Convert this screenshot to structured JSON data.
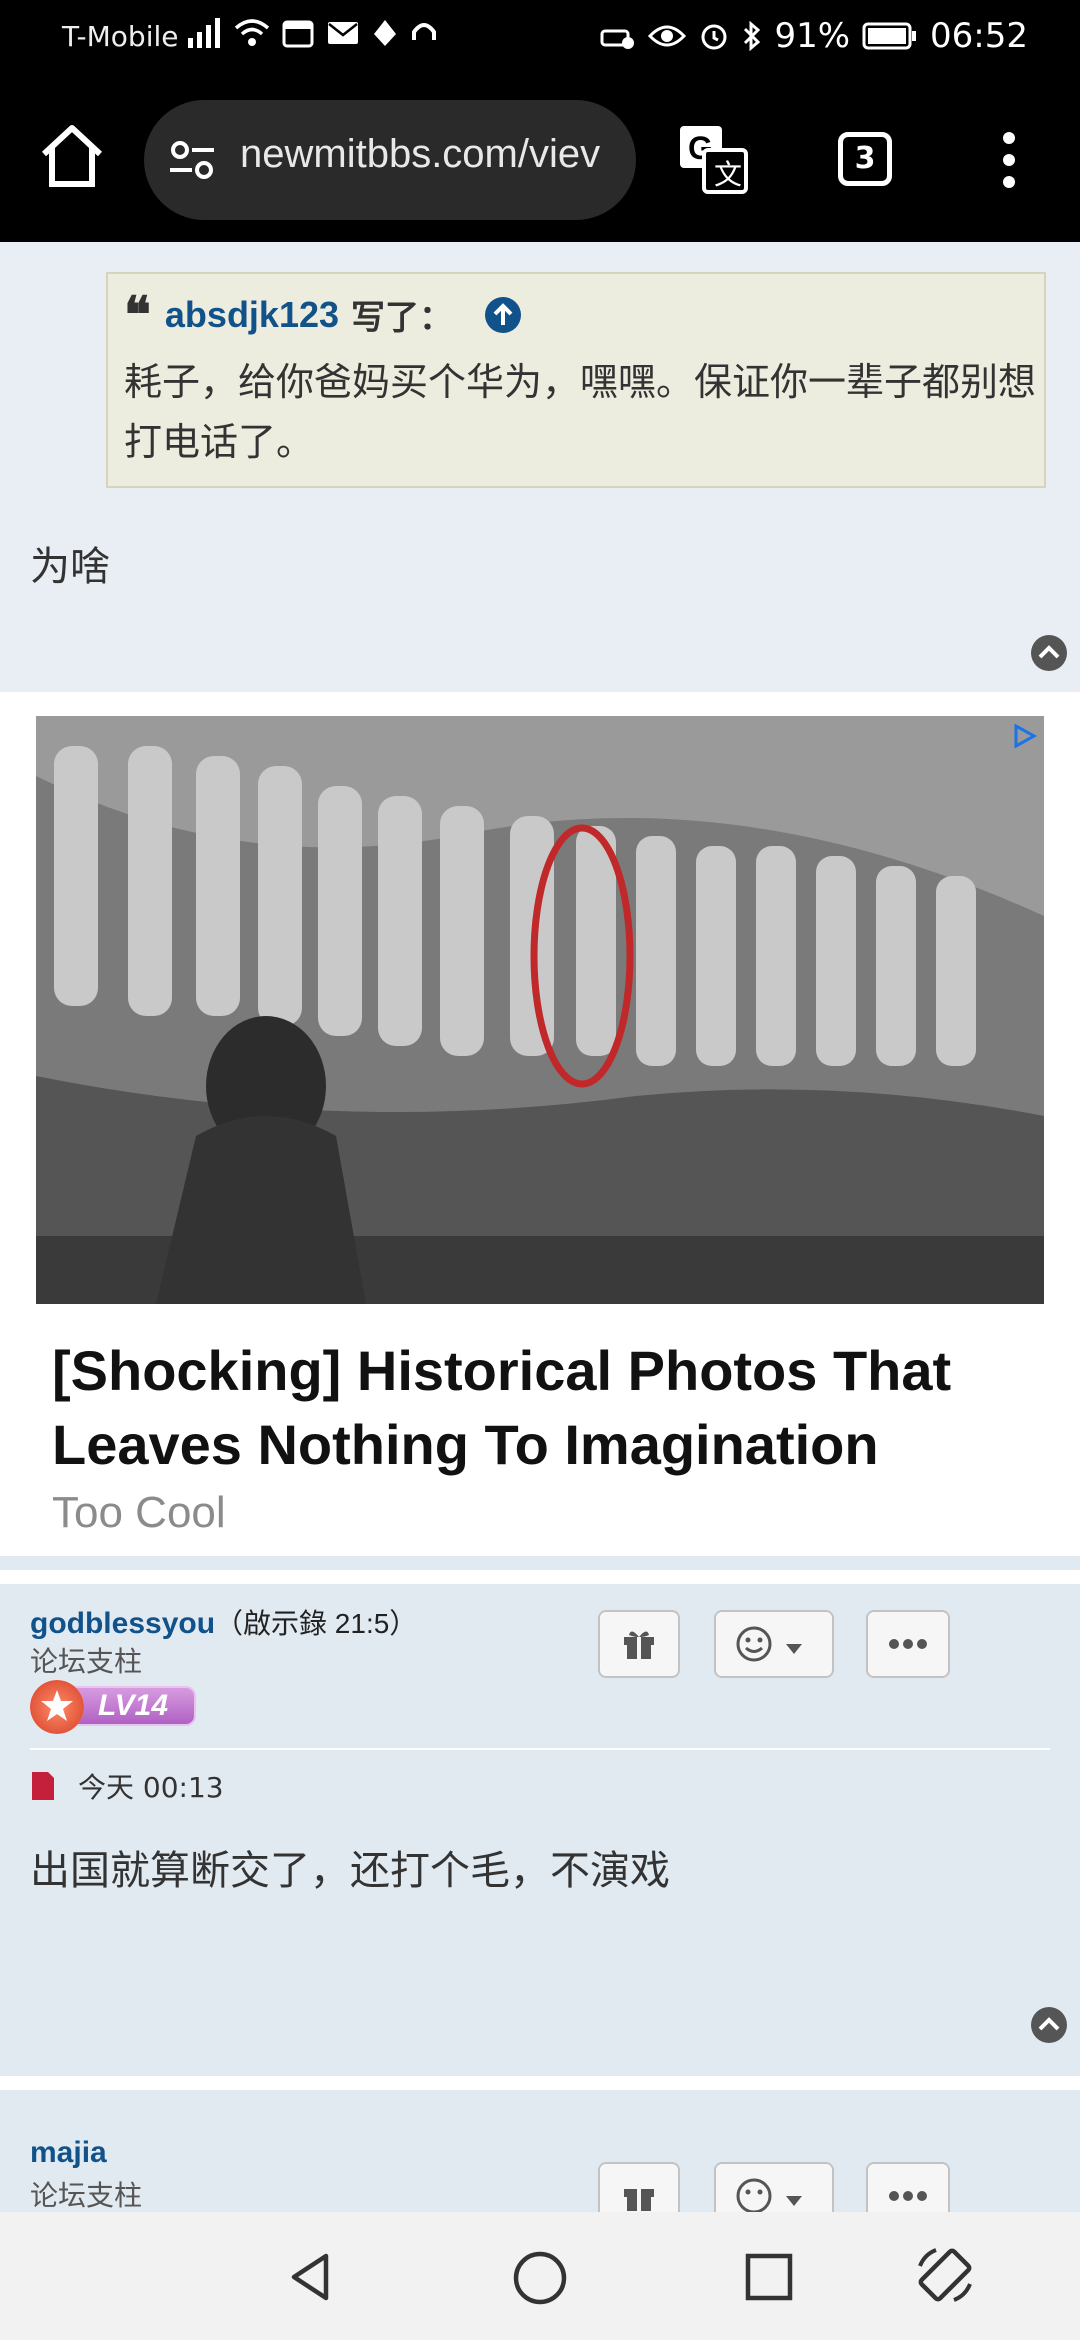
{
  "status_bar": {
    "carrier": "T-Mobile",
    "battery": "91%",
    "time": "06:52"
  },
  "browser": {
    "url": "newmitbbs.com/viev",
    "tab_count": "3"
  },
  "post1": {
    "quote_author": "absdjk123",
    "quote_wrote": "写了：",
    "quote_text": "耗子，给你爸妈买个华为，嘿嘿。保证你一辈子都别想打电话了。",
    "text": "为啥"
  },
  "ad": {
    "title": "[Shocking] Historical Photos That Leaves Nothing To Imagination",
    "source": "Too Cool"
  },
  "post2": {
    "author": "godblessyou",
    "author_extra": "（啟示錄 21:5）",
    "rank": "论坛支柱",
    "level": "LV14",
    "time": "今天 00:13",
    "text": "出国就算断交了，还打个毛，不演戏"
  },
  "post3": {
    "author": "majia",
    "rank": "论坛支柱"
  },
  "colors": {
    "link_blue": "#105289",
    "post_bg": "#e2eaf1",
    "quote_bg": "#ececdf"
  }
}
